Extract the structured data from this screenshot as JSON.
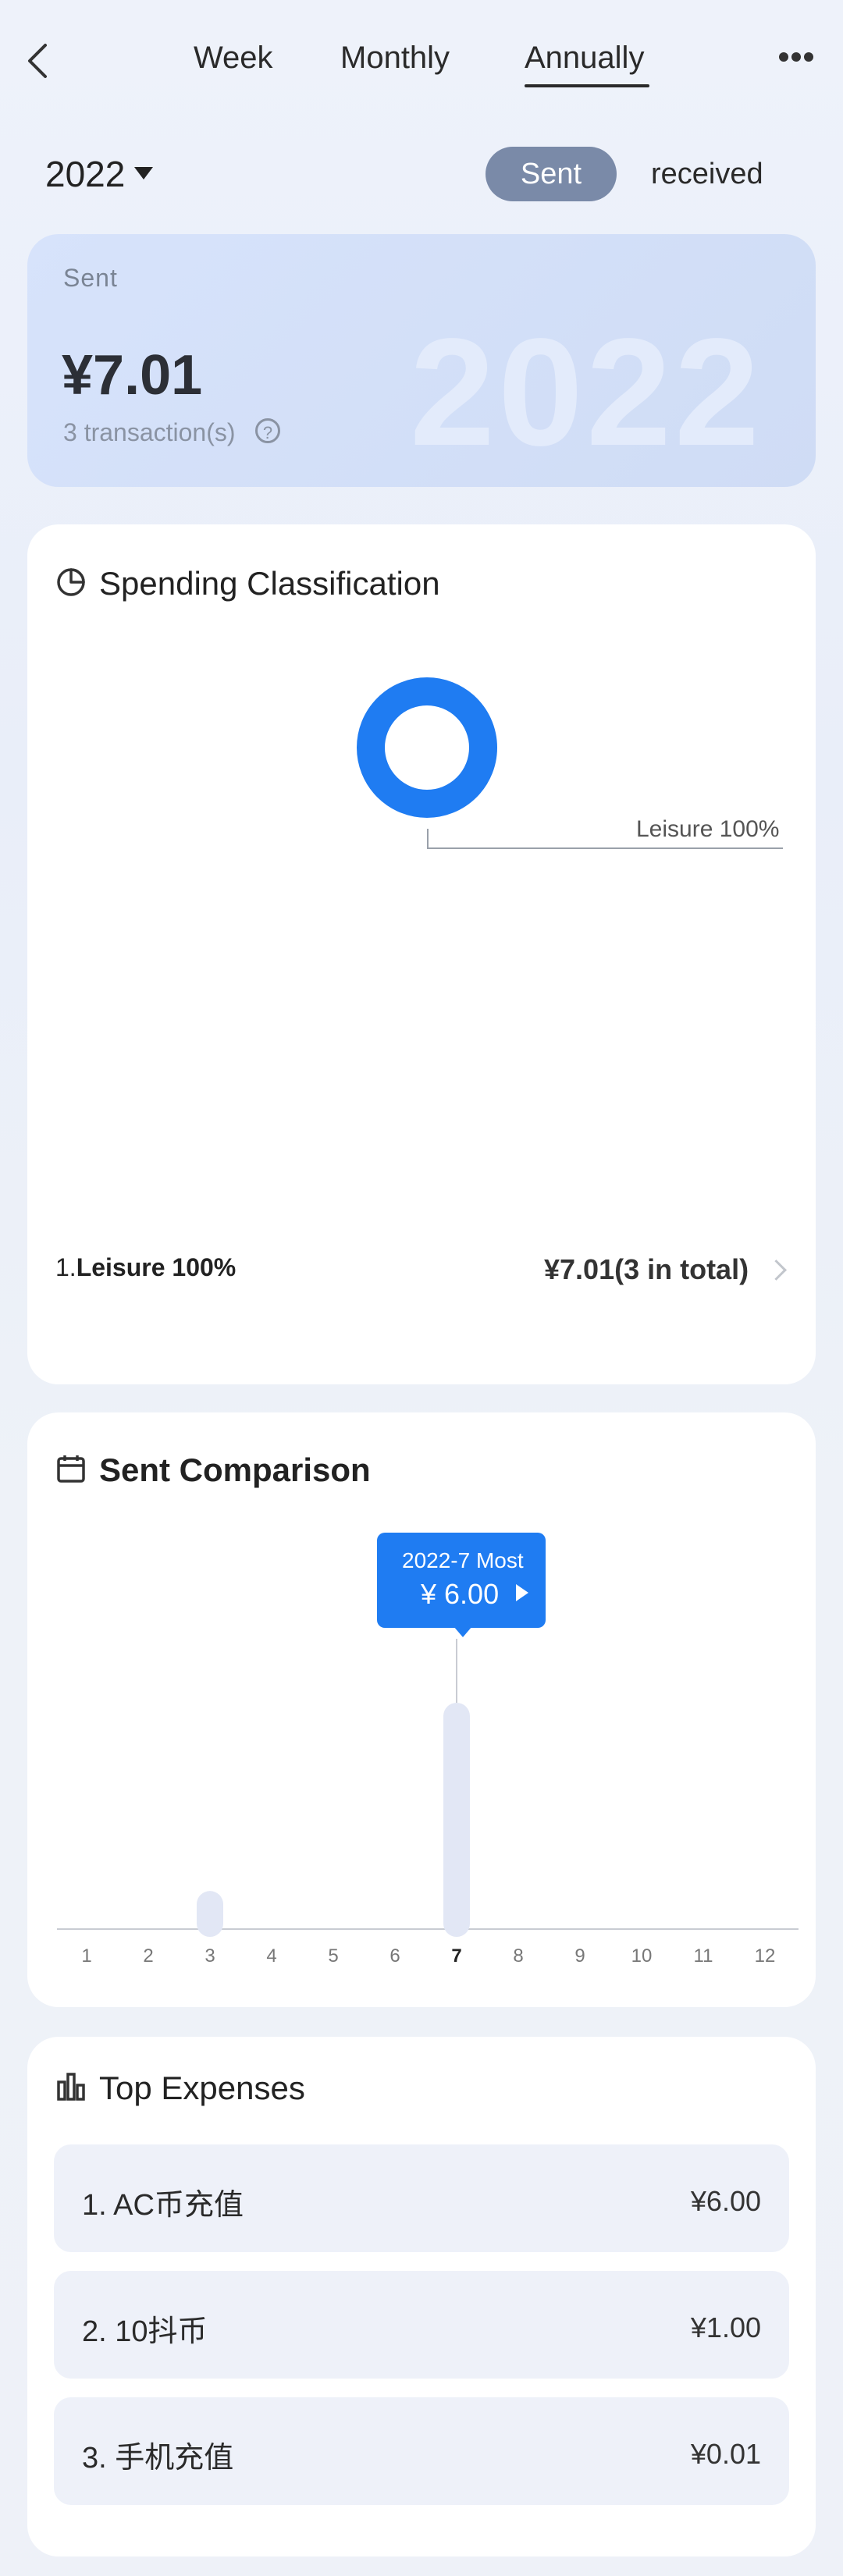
{
  "topbar": {
    "tabs": [
      "Week",
      "Monthly",
      "Annually"
    ],
    "active_tab": "Annually"
  },
  "filter": {
    "year": "2022",
    "sent_label": "Sent",
    "received_label": "received"
  },
  "summary": {
    "label": "Sent",
    "amount": "¥7.01",
    "count": "3 transaction(s)",
    "watermark": "2022"
  },
  "classification": {
    "title": "Spending Classification",
    "donut_label": "Leisure 100%",
    "legend_prefix": "1.",
    "legend_name": "Leisure 100%",
    "legend_total": "¥7.01(3 in total)",
    "chart_data": {
      "type": "pie",
      "slices": [
        {
          "label": "Leisure",
          "value": 100
        }
      ]
    }
  },
  "comparison": {
    "title": "Sent Comparison",
    "tooltip_title": "2022-7 Most",
    "tooltip_value": "¥ 6.00",
    "chart_data": {
      "type": "bar",
      "categories": [
        "1",
        "2",
        "3",
        "4",
        "5",
        "6",
        "7",
        "8",
        "9",
        "10",
        "11",
        "12"
      ],
      "values": [
        0,
        0,
        1.01,
        0,
        0,
        0,
        6.0,
        0,
        0,
        0,
        0,
        0
      ],
      "highlight": "7",
      "ylim": [
        0,
        6.5
      ]
    }
  },
  "top_expenses": {
    "title": "Top Expenses",
    "items": [
      {
        "name": "1. AC币充值",
        "amount": "¥6.00"
      },
      {
        "name": "2. 10抖币",
        "amount": "¥1.00"
      },
      {
        "name": "3. 手机充值",
        "amount": "¥0.01"
      }
    ]
  },
  "colors": {
    "accent": "#1f7cf2",
    "bar": "#e2e7f5"
  }
}
